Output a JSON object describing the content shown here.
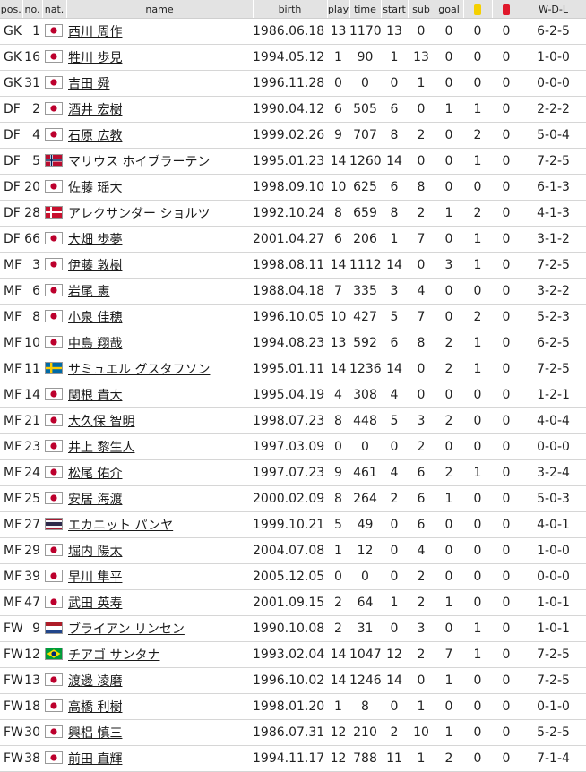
{
  "headers": {
    "pos": "pos.",
    "no": "no.",
    "nat": "nat.",
    "name": "name",
    "birth": "birth",
    "play": "play",
    "time": "time",
    "start": "start",
    "sub": "sub",
    "goal": "goal",
    "wdl": "W-D-L"
  },
  "card_colors": {
    "yellow": "#f5d000",
    "red": "#e0182b"
  },
  "rows": [
    {
      "pos": "GK",
      "no": "1",
      "nat": "jpn",
      "name": "西川 周作",
      "birth": "1986.06.18",
      "play": "13",
      "time": "1170",
      "start": "13",
      "sub": "0",
      "goal": "0",
      "yellow": "0",
      "red": "0",
      "wdl": "6-2-5"
    },
    {
      "pos": "GK",
      "no": "16",
      "nat": "jpn",
      "name": "牲川 歩見",
      "birth": "1994.05.12",
      "play": "1",
      "time": "90",
      "start": "1",
      "sub": "13",
      "goal": "0",
      "yellow": "0",
      "red": "0",
      "wdl": "1-0-0"
    },
    {
      "pos": "GK",
      "no": "31",
      "nat": "jpn",
      "name": "吉田 舜",
      "birth": "1996.11.28",
      "play": "0",
      "time": "0",
      "start": "0",
      "sub": "1",
      "goal": "0",
      "yellow": "0",
      "red": "0",
      "wdl": "0-0-0"
    },
    {
      "pos": "DF",
      "no": "2",
      "nat": "jpn",
      "name": "酒井 宏樹",
      "birth": "1990.04.12",
      "play": "6",
      "time": "505",
      "start": "6",
      "sub": "0",
      "goal": "1",
      "yellow": "1",
      "red": "0",
      "wdl": "2-2-2"
    },
    {
      "pos": "DF",
      "no": "4",
      "nat": "jpn",
      "name": "石原 広教",
      "birth": "1999.02.26",
      "play": "9",
      "time": "707",
      "start": "8",
      "sub": "2",
      "goal": "0",
      "yellow": "2",
      "red": "0",
      "wdl": "5-0-4"
    },
    {
      "pos": "DF",
      "no": "5",
      "nat": "nor",
      "name": "マリウス ホイブラーテン",
      "birth": "1995.01.23",
      "play": "14",
      "time": "1260",
      "start": "14",
      "sub": "0",
      "goal": "0",
      "yellow": "1",
      "red": "0",
      "wdl": "7-2-5"
    },
    {
      "pos": "DF",
      "no": "20",
      "nat": "jpn",
      "name": "佐藤 瑶大",
      "birth": "1998.09.10",
      "play": "10",
      "time": "625",
      "start": "6",
      "sub": "8",
      "goal": "0",
      "yellow": "0",
      "red": "0",
      "wdl": "6-1-3"
    },
    {
      "pos": "DF",
      "no": "28",
      "nat": "den",
      "name": "アレクサンダー ショルツ",
      "birth": "1992.10.24",
      "play": "8",
      "time": "659",
      "start": "8",
      "sub": "2",
      "goal": "1",
      "yellow": "2",
      "red": "0",
      "wdl": "4-1-3"
    },
    {
      "pos": "DF",
      "no": "66",
      "nat": "jpn",
      "name": "大畑 歩夢",
      "birth": "2001.04.27",
      "play": "6",
      "time": "206",
      "start": "1",
      "sub": "7",
      "goal": "0",
      "yellow": "1",
      "red": "0",
      "wdl": "3-1-2"
    },
    {
      "pos": "MF",
      "no": "3",
      "nat": "jpn",
      "name": "伊藤 敦樹",
      "birth": "1998.08.11",
      "play": "14",
      "time": "1112",
      "start": "14",
      "sub": "0",
      "goal": "3",
      "yellow": "1",
      "red": "0",
      "wdl": "7-2-5"
    },
    {
      "pos": "MF",
      "no": "6",
      "nat": "jpn",
      "name": "岩尾 憲",
      "birth": "1988.04.18",
      "play": "7",
      "time": "335",
      "start": "3",
      "sub": "4",
      "goal": "0",
      "yellow": "0",
      "red": "0",
      "wdl": "3-2-2"
    },
    {
      "pos": "MF",
      "no": "8",
      "nat": "jpn",
      "name": "小泉 佳穂",
      "birth": "1996.10.05",
      "play": "10",
      "time": "427",
      "start": "5",
      "sub": "7",
      "goal": "0",
      "yellow": "2",
      "red": "0",
      "wdl": "5-2-3"
    },
    {
      "pos": "MF",
      "no": "10",
      "nat": "jpn",
      "name": "中島 翔哉",
      "birth": "1994.08.23",
      "play": "13",
      "time": "592",
      "start": "6",
      "sub": "8",
      "goal": "2",
      "yellow": "1",
      "red": "0",
      "wdl": "6-2-5"
    },
    {
      "pos": "MF",
      "no": "11",
      "nat": "swe",
      "name": "サミュエル グスタフソン",
      "birth": "1995.01.11",
      "play": "14",
      "time": "1236",
      "start": "14",
      "sub": "0",
      "goal": "2",
      "yellow": "1",
      "red": "0",
      "wdl": "7-2-5"
    },
    {
      "pos": "MF",
      "no": "14",
      "nat": "jpn",
      "name": "関根 貴大",
      "birth": "1995.04.19",
      "play": "4",
      "time": "308",
      "start": "4",
      "sub": "0",
      "goal": "0",
      "yellow": "0",
      "red": "0",
      "wdl": "1-2-1"
    },
    {
      "pos": "MF",
      "no": "21",
      "nat": "jpn",
      "name": "大久保 智明",
      "birth": "1998.07.23",
      "play": "8",
      "time": "448",
      "start": "5",
      "sub": "3",
      "goal": "2",
      "yellow": "0",
      "red": "0",
      "wdl": "4-0-4"
    },
    {
      "pos": "MF",
      "no": "23",
      "nat": "jpn",
      "name": "井上 黎生人",
      "birth": "1997.03.09",
      "play": "0",
      "time": "0",
      "start": "0",
      "sub": "2",
      "goal": "0",
      "yellow": "0",
      "red": "0",
      "wdl": "0-0-0"
    },
    {
      "pos": "MF",
      "no": "24",
      "nat": "jpn",
      "name": "松尾 佑介",
      "birth": "1997.07.23",
      "play": "9",
      "time": "461",
      "start": "4",
      "sub": "6",
      "goal": "2",
      "yellow": "1",
      "red": "0",
      "wdl": "3-2-4"
    },
    {
      "pos": "MF",
      "no": "25",
      "nat": "jpn",
      "name": "安居 海渡",
      "birth": "2000.02.09",
      "play": "8",
      "time": "264",
      "start": "2",
      "sub": "6",
      "goal": "1",
      "yellow": "0",
      "red": "0",
      "wdl": "5-0-3"
    },
    {
      "pos": "MF",
      "no": "27",
      "nat": "tha",
      "name": "エカニット パンヤ",
      "birth": "1999.10.21",
      "play": "5",
      "time": "49",
      "start": "0",
      "sub": "6",
      "goal": "0",
      "yellow": "0",
      "red": "0",
      "wdl": "4-0-1"
    },
    {
      "pos": "MF",
      "no": "29",
      "nat": "jpn",
      "name": "堀内 陽太",
      "birth": "2004.07.08",
      "play": "1",
      "time": "12",
      "start": "0",
      "sub": "4",
      "goal": "0",
      "yellow": "0",
      "red": "0",
      "wdl": "1-0-0"
    },
    {
      "pos": "MF",
      "no": "39",
      "nat": "jpn",
      "name": "早川 隼平",
      "birth": "2005.12.05",
      "play": "0",
      "time": "0",
      "start": "0",
      "sub": "2",
      "goal": "0",
      "yellow": "0",
      "red": "0",
      "wdl": "0-0-0"
    },
    {
      "pos": "MF",
      "no": "47",
      "nat": "jpn",
      "name": "武田 英寿",
      "birth": "2001.09.15",
      "play": "2",
      "time": "64",
      "start": "1",
      "sub": "2",
      "goal": "1",
      "yellow": "0",
      "red": "0",
      "wdl": "1-0-1"
    },
    {
      "pos": "FW",
      "no": "9",
      "nat": "ned",
      "name": "ブライアン リンセン",
      "birth": "1990.10.08",
      "play": "2",
      "time": "31",
      "start": "0",
      "sub": "3",
      "goal": "0",
      "yellow": "1",
      "red": "0",
      "wdl": "1-0-1"
    },
    {
      "pos": "FW",
      "no": "12",
      "nat": "bra",
      "name": "チアゴ サンタナ",
      "birth": "1993.02.04",
      "play": "14",
      "time": "1047",
      "start": "12",
      "sub": "2",
      "goal": "7",
      "yellow": "1",
      "red": "0",
      "wdl": "7-2-5"
    },
    {
      "pos": "FW",
      "no": "13",
      "nat": "jpn",
      "name": "渡邊 凌磨",
      "birth": "1996.10.02",
      "play": "14",
      "time": "1246",
      "start": "14",
      "sub": "0",
      "goal": "1",
      "yellow": "0",
      "red": "0",
      "wdl": "7-2-5"
    },
    {
      "pos": "FW",
      "no": "18",
      "nat": "jpn",
      "name": "高橋 利樹",
      "birth": "1998.01.20",
      "play": "1",
      "time": "8",
      "start": "0",
      "sub": "1",
      "goal": "0",
      "yellow": "0",
      "red": "0",
      "wdl": "0-1-0"
    },
    {
      "pos": "FW",
      "no": "30",
      "nat": "jpn",
      "name": "興梠 慎三",
      "birth": "1986.07.31",
      "play": "12",
      "time": "210",
      "start": "2",
      "sub": "10",
      "goal": "1",
      "yellow": "0",
      "red": "0",
      "wdl": "5-2-5"
    },
    {
      "pos": "FW",
      "no": "38",
      "nat": "jpn",
      "name": "前田 直輝",
      "birth": "1994.11.17",
      "play": "12",
      "time": "788",
      "start": "11",
      "sub": "1",
      "goal": "2",
      "yellow": "0",
      "red": "0",
      "wdl": "7-1-4"
    }
  ]
}
